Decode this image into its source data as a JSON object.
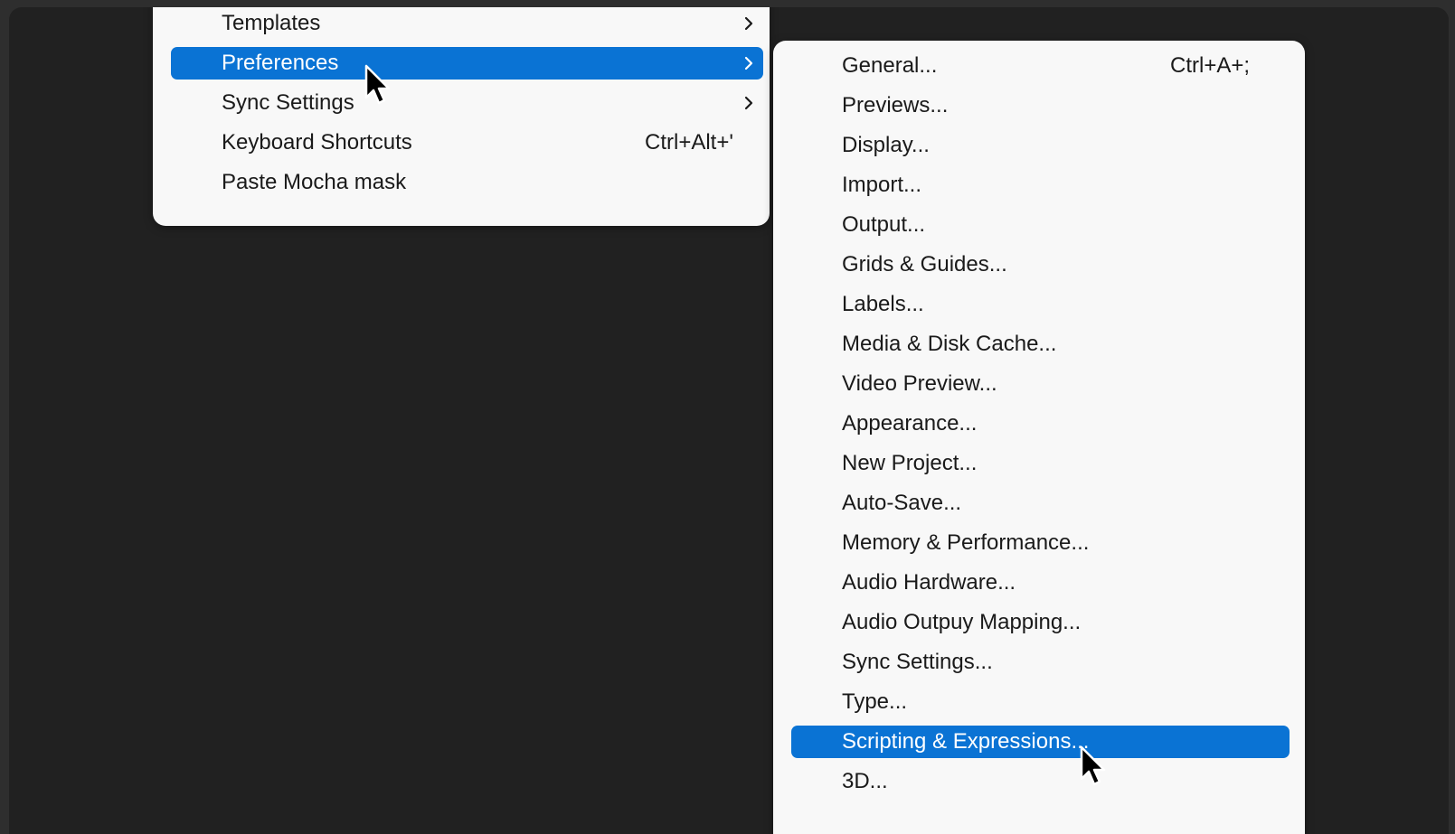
{
  "main_menu": {
    "items": [
      {
        "label": "Templates",
        "shortcut": "",
        "submenu": true,
        "active": false
      },
      {
        "label": "Preferences",
        "shortcut": "",
        "submenu": true,
        "active": true
      },
      {
        "label": "Sync Settings",
        "shortcut": "",
        "submenu": true,
        "active": false
      },
      {
        "label": "Keyboard Shortcuts",
        "shortcut": "Ctrl+Alt+'",
        "submenu": false,
        "active": false
      },
      {
        "label": "Paste Mocha mask",
        "shortcut": "",
        "submenu": false,
        "active": false
      }
    ]
  },
  "preferences_submenu": {
    "items": [
      {
        "label": "General...",
        "shortcut": "Ctrl+A+;"
      },
      {
        "label": "Previews...",
        "shortcut": ""
      },
      {
        "label": "Display...",
        "shortcut": ""
      },
      {
        "label": "Import...",
        "shortcut": ""
      },
      {
        "label": "Output...",
        "shortcut": ""
      },
      {
        "label": "Grids & Guides...",
        "shortcut": ""
      },
      {
        "label": "Labels...",
        "shortcut": ""
      },
      {
        "label": "Media & Disk Cache...",
        "shortcut": ""
      },
      {
        "label": "Video Preview...",
        "shortcut": ""
      },
      {
        "label": "Appearance...",
        "shortcut": ""
      },
      {
        "label": "New Project...",
        "shortcut": ""
      },
      {
        "label": "Auto-Save...",
        "shortcut": ""
      },
      {
        "label": "Memory & Performance...",
        "shortcut": ""
      },
      {
        "label": "Audio Hardware...",
        "shortcut": ""
      },
      {
        "label": "Audio Outpuy Mapping...",
        "shortcut": ""
      },
      {
        "label": "Sync Settings...",
        "shortcut": ""
      },
      {
        "label": "Type...",
        "shortcut": ""
      },
      {
        "label": "Scripting & Expressions...",
        "shortcut": ""
      },
      {
        "label": "3D...",
        "shortcut": ""
      }
    ],
    "active_index": 17
  },
  "colors": {
    "highlight": "#0a73d4",
    "menu_background": "#f8f8f8",
    "app_background": "#212121",
    "text": "#1a1a1a"
  },
  "icons": {
    "submenu_arrow": "chevron-right-icon",
    "pointer": "mouse-cursor-icon"
  }
}
